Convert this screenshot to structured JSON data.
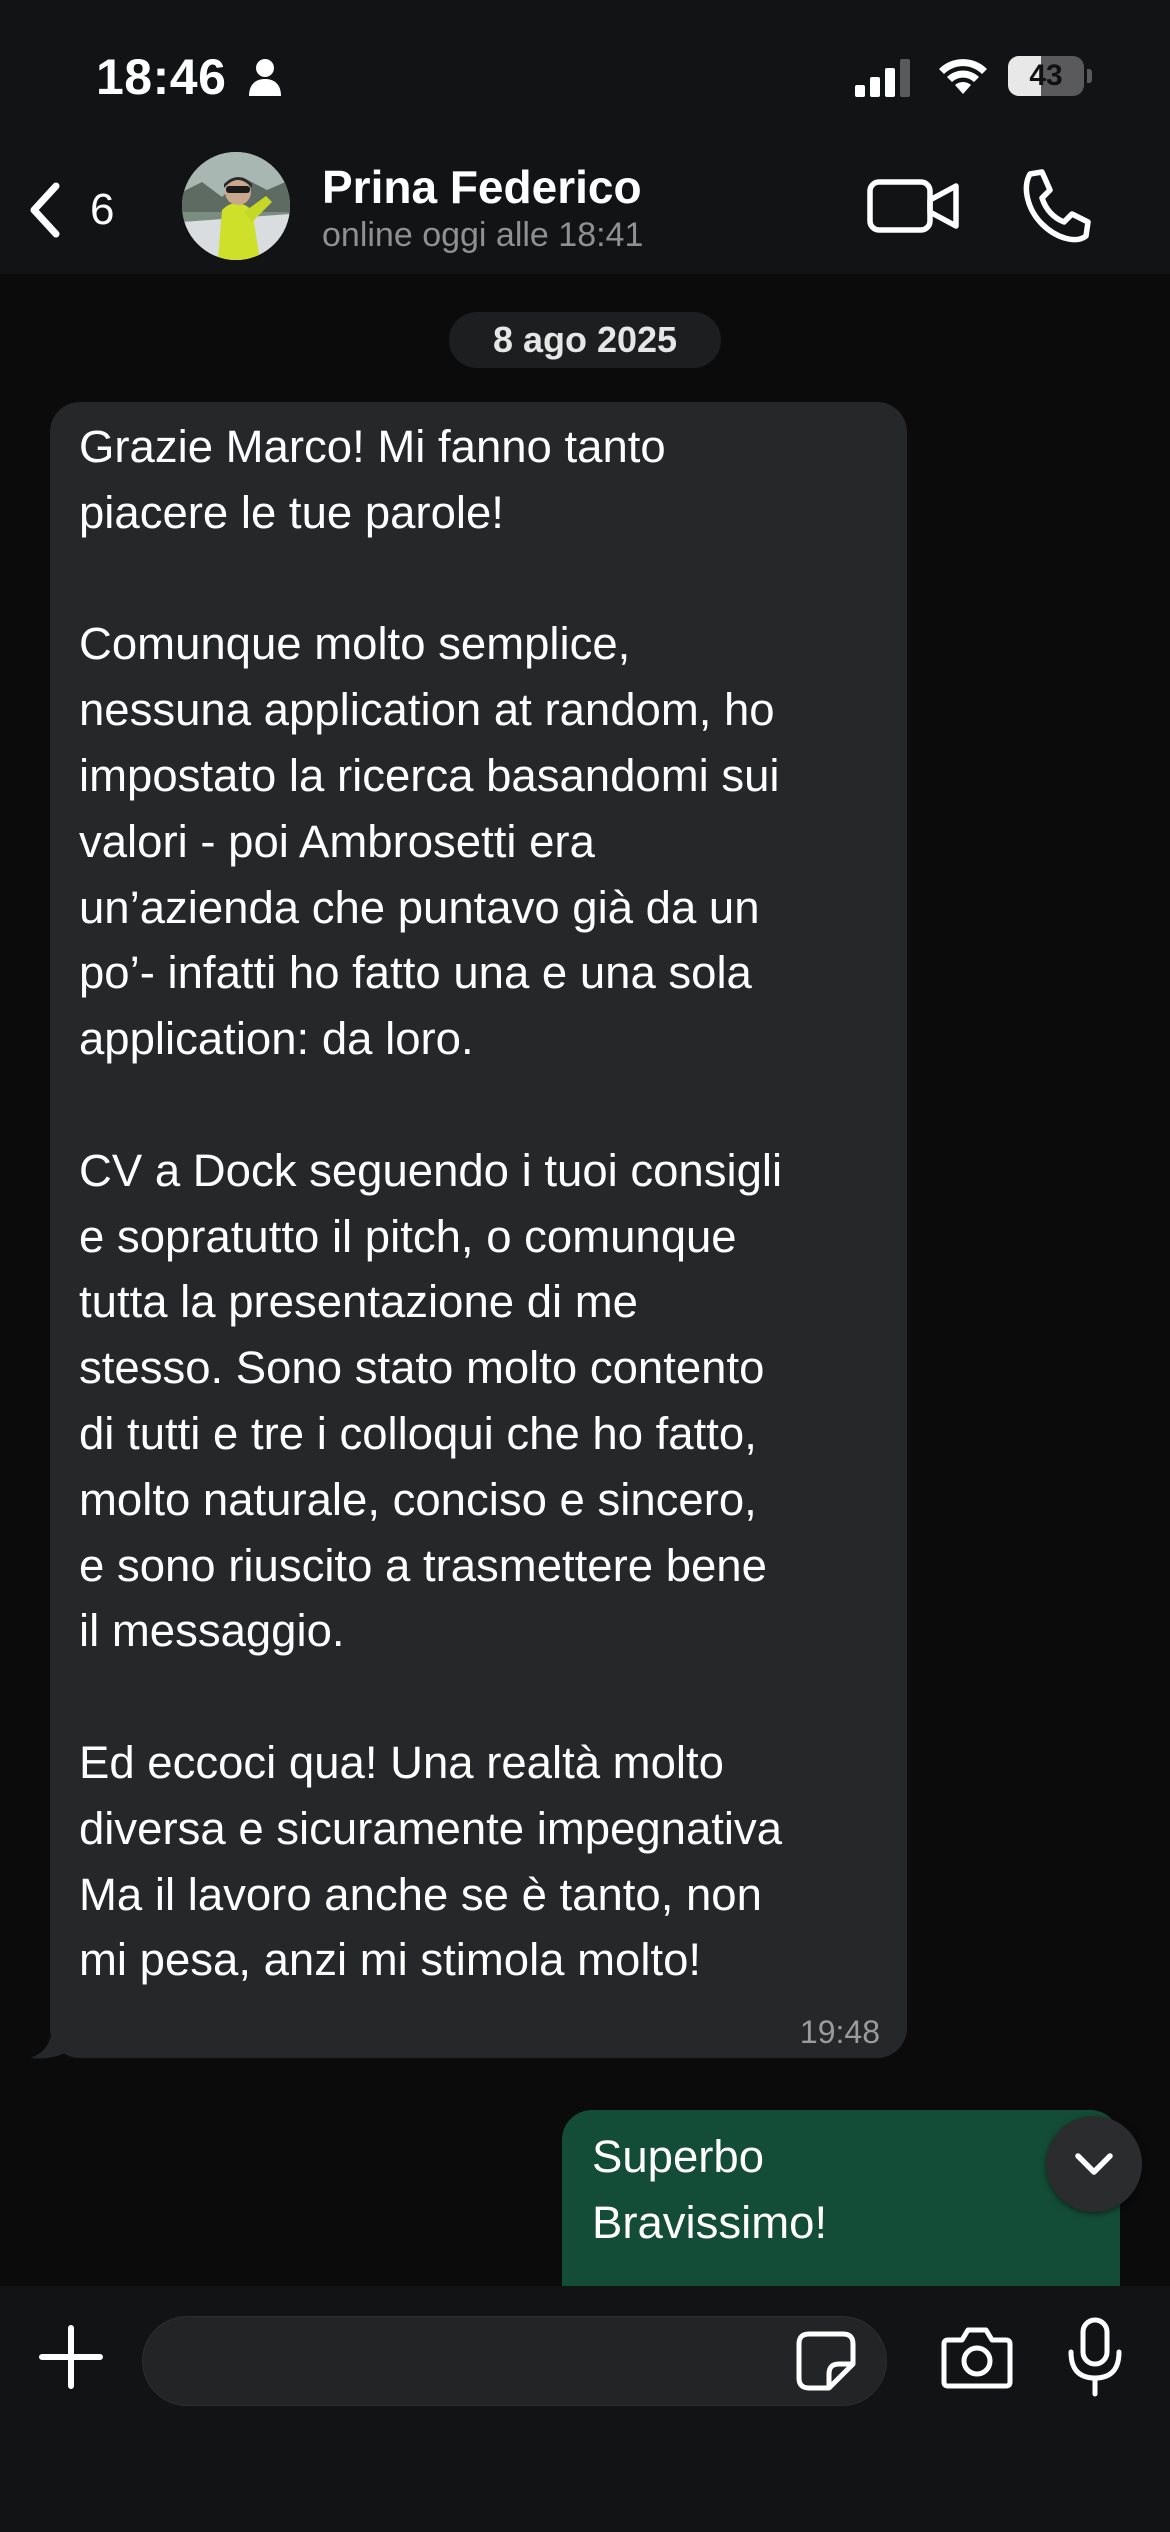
{
  "status_bar": {
    "time": "18:46",
    "battery_level": "43",
    "battery_fraction": 0.43
  },
  "header": {
    "back_count": "6",
    "contact_name": "Prina Federico",
    "contact_status": "online oggi alle 18:41"
  },
  "chat": {
    "date_separator": "8 ago 2025",
    "messages": [
      {
        "direction": "incoming",
        "text": "Grazie Marco! Mi fanno tanto\npiacere le tue parole!\n\nComunque molto semplice,\nnessuna application at random, ho\nimpostato la ricerca basandomi sui\nvalori - poi Ambrosetti era\nun’azienda che puntavo già da un\npo’- infatti ho fatto una e una sola\napplication: da loro.\n\nCV a Dock seguendo i tuoi consigli\ne sopratutto il pitch, o comunque\ntutta la presentazione di me\nstesso. Sono stato molto contento\ndi tutti e tre i colloqui che ho fatto,\nmolto naturale, conciso e sincero,\ne sono riuscito a trasmettere bene\nil messaggio.\n\nEd eccoci qua! Una realtà molto\ndiversa e sicuramente impegnativa\nMa il lavoro anche se è tanto, non\nmi pesa, anzi mi stimola molto!",
        "time": "19:48"
      },
      {
        "direction": "outgoing",
        "text": "Superbo\nBravissimo!"
      }
    ]
  },
  "composer": {
    "input_value": "",
    "input_placeholder": ""
  },
  "colors": {
    "background": "#0b0b0c",
    "bar": "#121314",
    "incoming_bubble": "#262728",
    "outgoing_bubble": "#144d37"
  },
  "icons": {
    "back": "chevron-left-icon",
    "video_call": "video-camera-icon",
    "voice_call": "phone-icon",
    "scroll_down": "chevron-down-icon",
    "attach": "plus-icon",
    "sticker": "sticker-icon",
    "camera": "camera-icon",
    "mic": "microphone-icon"
  }
}
